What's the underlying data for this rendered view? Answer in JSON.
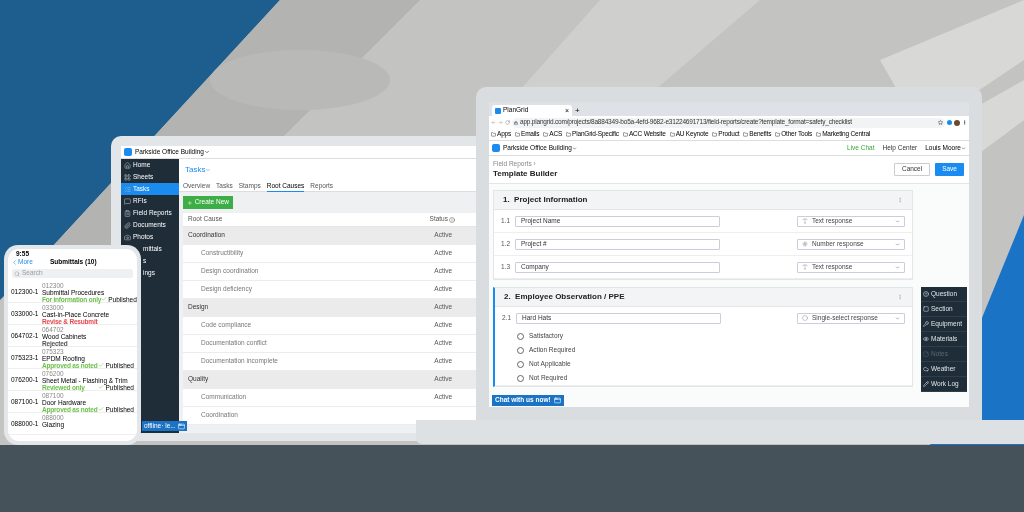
{
  "laptop": {
    "browser": {
      "tab_title": "PlanGrid",
      "tab_close": "×",
      "new_tab": "+",
      "url": "app.plangrid.com/projects/8a884349-bo5a-4efd-9682-e31224691713/field-reports/create?template_format=safety_checklist",
      "bookmarks": [
        "Apps",
        "Emails",
        "ACS",
        "PlanGrid-Specific",
        "ACC Website",
        "AU Keynote",
        "Product",
        "Benefits",
        "Other Tools",
        "Marketing Central"
      ]
    },
    "app": {
      "project": "Parkside Office Building",
      "links": [
        {
          "label": "Live Chat",
          "kind": "live"
        },
        {
          "label": "Help Center",
          "kind": "plain"
        }
      ],
      "user": "Louis Moore",
      "breadcrumb": "Field Reports ›",
      "title": "Template Builder",
      "buttons": [
        {
          "label": "Cancel",
          "kind": "secondary"
        },
        {
          "label": "Save",
          "kind": "primary"
        }
      ],
      "sections": [
        {
          "title": "1.  Project Information",
          "active": false,
          "questions": [
            {
              "number": "1.1",
              "label": "Project Name",
              "response": "Text response",
              "kind": "text"
            },
            {
              "number": "1.2",
              "label": "Project #",
              "response": "Number response",
              "kind": "number"
            },
            {
              "number": "1.3",
              "label": "Company",
              "response": "Text response",
              "kind": "text"
            }
          ]
        },
        {
          "title": "2.  Employee Observation / PPE",
          "active": true,
          "questions": [
            {
              "number": "2.1",
              "label": "Hard Hats",
              "response": "Single-select response",
              "kind": "single",
              "options": [
                "Satisfactory",
                "Action Required",
                "Not Applicable",
                "Not Required"
              ]
            }
          ]
        }
      ],
      "toolbar": [
        {
          "label": "Question",
          "disabled": false
        },
        {
          "label": "Section",
          "disabled": false
        },
        {
          "label": "Equipment",
          "disabled": false
        },
        {
          "label": "Materials",
          "disabled": false
        },
        {
          "label": "Notes",
          "disabled": true
        },
        {
          "label": "Weather",
          "disabled": false
        },
        {
          "label": "Work Log",
          "disabled": false
        }
      ],
      "chat_button": "Chat with us now!"
    }
  },
  "tablet": {
    "project": "Parkside Office Building",
    "nav": [
      {
        "label": "Home",
        "selected": false,
        "clipped": false
      },
      {
        "label": "Sheets",
        "selected": false,
        "clipped": false
      },
      {
        "label": "Tasks",
        "selected": true,
        "clipped": false
      },
      {
        "label": "RFIs",
        "selected": false,
        "clipped": false
      },
      {
        "label": "Field Reports",
        "selected": false,
        "clipped": false
      },
      {
        "label": "Documents",
        "selected": false,
        "clipped": false
      },
      {
        "label": "Photos",
        "selected": false,
        "clipped": false
      },
      {
        "label": "mittals",
        "selected": false,
        "clipped": true
      },
      {
        "label": "s",
        "selected": false,
        "clipped": true
      },
      {
        "label": "ings",
        "selected": false,
        "clipped": true
      }
    ],
    "title": "Tasks",
    "tabs": [
      {
        "label": "Overview",
        "selected": false
      },
      {
        "label": "Tasks",
        "selected": false
      },
      {
        "label": "Stamps",
        "selected": false
      },
      {
        "label": "Root Causes",
        "selected": true
      },
      {
        "label": "Reports",
        "selected": false
      }
    ],
    "create_button": "Create New",
    "columns": [
      "Root Cause",
      "Status"
    ],
    "rows": [
      {
        "cause": "Coordination",
        "status": "Active",
        "kind": "group"
      },
      {
        "cause": "Constructibility",
        "status": "Active",
        "kind": "child"
      },
      {
        "cause": "Design coordination",
        "status": "Active",
        "kind": "child"
      },
      {
        "cause": "Design deficiency",
        "status": "Active",
        "kind": "child"
      },
      {
        "cause": "Design",
        "status": "Active",
        "kind": "group"
      },
      {
        "cause": "Code compliance",
        "status": "Active",
        "kind": "child"
      },
      {
        "cause": "Documentation conflict",
        "status": "Active",
        "kind": "child"
      },
      {
        "cause": "Documentation incomplete",
        "status": "Active",
        "kind": "child"
      },
      {
        "cause": "Quality",
        "status": "Active",
        "kind": "group"
      },
      {
        "cause": "Communication",
        "status": "Active",
        "kind": "child"
      },
      {
        "cause": "Coordination",
        "kind": "child"
      }
    ],
    "offline_banner": "offline· le..."
  },
  "phone": {
    "time": "9:55",
    "back": "More",
    "title": "Submittals (10)",
    "search_placeholder": "Search",
    "rows": [
      {
        "number": "012300-1",
        "code": "012300",
        "title": "Submittal Procedures",
        "status": "For information only",
        "color": "#6cc04a",
        "published": "Published"
      },
      {
        "number": "033000-1",
        "code": "033000",
        "title": "Cast-in-Place Concrete",
        "status": "Revise & Resubmit",
        "color": "#e5484d"
      },
      {
        "number": "064702-1",
        "code": "064702",
        "title": "Wood Cabinets",
        "status": "Rejected",
        "color": "#555555"
      },
      {
        "number": "075323-1",
        "code": "075323",
        "title": "EPDM Roofing",
        "status": "Approved as noted",
        "color": "#6cc04a",
        "published": "Published"
      },
      {
        "number": "076200-1",
        "code": "076200",
        "title": "Sheet Metal - Flashing & Trim",
        "status": "Reviewed only",
        "color": "#6cc04a",
        "published": "Published"
      },
      {
        "number": "087100-1",
        "code": "087100",
        "title": "Door Hardware",
        "status": "Approved as noted",
        "color": "#6cc04a",
        "published": "Published"
      },
      {
        "number": "088000-1",
        "code": "088000",
        "title": "Glazing"
      }
    ]
  }
}
